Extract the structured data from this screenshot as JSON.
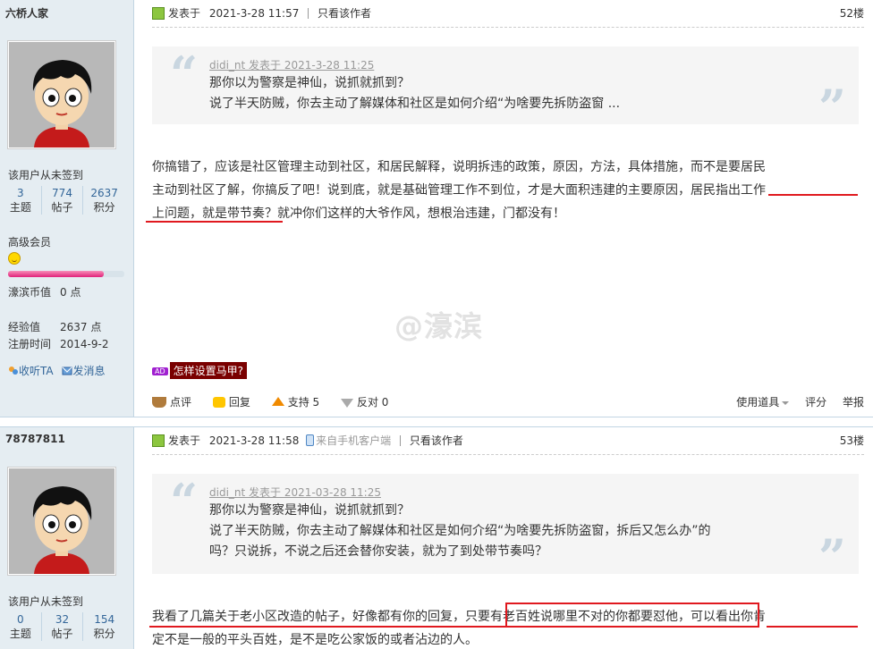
{
  "posts": [
    {
      "author": "六桥人家",
      "signin_status": "该用户从未签到",
      "stats": [
        {
          "value": "3",
          "label": "主题"
        },
        {
          "value": "774",
          "label": "帖子"
        },
        {
          "value": "2637",
          "label": "积分"
        }
      ],
      "rank": "高级会员",
      "rank_progress": 0.82,
      "hk_value_label": "濠滨币值",
      "hk_value": "0 点",
      "exp_label": "经验值",
      "exp_value": "2637 点",
      "reg_label": "注册时间",
      "reg_value": "2014-9-2",
      "follow_label": "收听TA",
      "message_label": "发消息",
      "posted_label": "发表于",
      "posted_time": "2021-3-28 11:57",
      "only_author": "只看该作者",
      "floor": "52楼",
      "quote_author": "didi_nt 发表于 2021-3-28 11:25",
      "quote_lines": [
        "那你以为警察是神仙，说抓就抓到？",
        "说了半天防贼，你去主动了解媒体和社区是如何介绍“为啥要先拆防盗窗 ..."
      ],
      "content_lines": [
        "你搞错了，应该是社区管理主动到社区，和居民解释，说明拆违的政策，原因，方法，具体措施，而不是要居民",
        "主动到社区了解，你搞反了吧！说到底，就是基础管理工作不到位，才是大面积违建的主要原因，居民指出工作",
        "上问题，就是带节奏？就冲你们这样的大爷作风，想根治违建，门都没有！"
      ],
      "ad_badge": "AD",
      "ad_text": "怎样设置马甲?",
      "watermark": "@濠滨",
      "ops": {
        "rate": "点评",
        "reply": "回复",
        "support": "支持 5",
        "oppose": "反对 0",
        "tools": "使用道具",
        "score": "评分",
        "report": "举报"
      }
    },
    {
      "author": "78787811",
      "signin_status": "该用户从未签到",
      "stats": [
        {
          "value": "0",
          "label": "主题"
        },
        {
          "value": "32",
          "label": "帖子"
        },
        {
          "value": "154",
          "label": "积分"
        }
      ],
      "posted_label": "发表于",
      "posted_time": "2021-3-28 11:58",
      "client": "来自手机客户端",
      "only_author": "只看该作者",
      "floor": "53楼",
      "quote_author": "didi_nt 发表于 2021-03-28 11:25",
      "quote_lines": [
        "那你以为警察是神仙，说抓就抓到？",
        "说了半天防贼，你去主动了解媒体和社区是如何介绍“为啥要先拆防盗窗，拆后又怎么办”的",
        "吗？只说拆，不说之后还会替你安装，就为了到处带节奏吗？"
      ],
      "content_lines": [
        "我看了几篇关于老小区改造的帖子，好像都有你的回复，只要有老百姓说哪里不对的你都要怼他，可以看出你肯",
        "定不是一般的平头百姓，是不是吃公家饭的或者沾边的人。"
      ]
    }
  ],
  "colors": {
    "sidebar_bg": "#e5edf2",
    "border": "#c2d5e3",
    "link": "#336699",
    "annotation_red": "#e0191f"
  }
}
